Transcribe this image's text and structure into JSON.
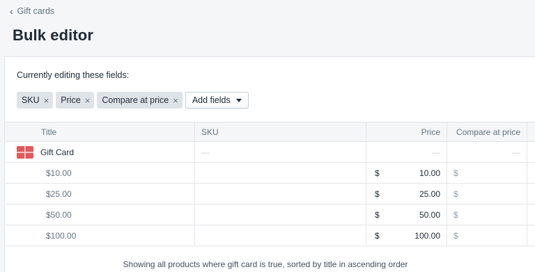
{
  "breadcrumb": {
    "label": "Gift cards"
  },
  "page": {
    "title": "Bulk editor"
  },
  "editor": {
    "editing_label": "Currently editing these fields:",
    "fields": [
      "SKU",
      "Price",
      "Compare at price"
    ],
    "add_fields_label": "Add fields"
  },
  "table": {
    "columns": [
      "Title",
      "SKU",
      "Price",
      "Compare at price"
    ],
    "product": {
      "title": "Gift Card",
      "sku": "—",
      "price": "—",
      "compare": "—"
    },
    "variants": [
      {
        "title": "$10.00",
        "currency": "$",
        "price": "10.00",
        "compare": "$"
      },
      {
        "title": "$25.00",
        "currency": "$",
        "price": "25.00",
        "compare": "$"
      },
      {
        "title": "$50.00",
        "currency": "$",
        "price": "50.00",
        "compare": "$"
      },
      {
        "title": "$100.00",
        "currency": "$",
        "price": "100.00",
        "compare": "$"
      }
    ]
  },
  "footer": {
    "note": "Showing all products where gift card is true, sorted by title in ascending order"
  },
  "colors": {
    "thumbnail": "#e05a5a",
    "tag_bg": "#dfe3e8"
  },
  "icons": {
    "back": "chevron-left-icon",
    "remove_tag": "close-icon",
    "dropdown": "caret-down-icon",
    "product_image": "gift-card-icon"
  }
}
